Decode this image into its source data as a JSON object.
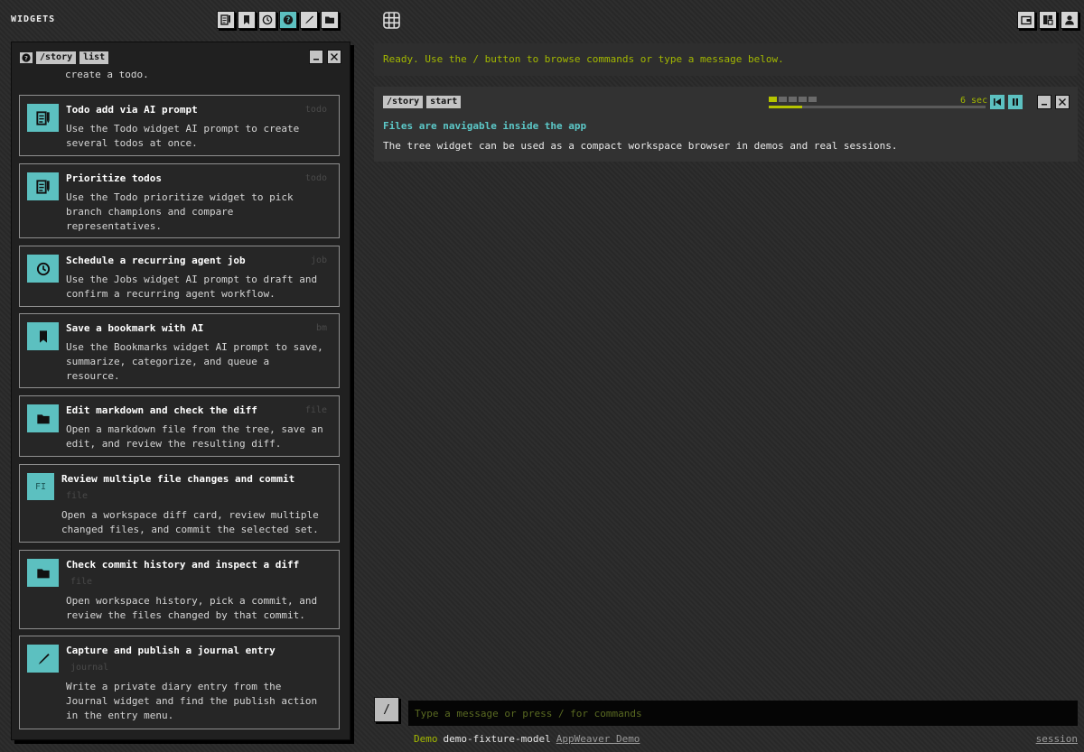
{
  "sidebar": {
    "title": "WIDGETS",
    "tools": [
      {
        "icon": "todo-icon",
        "active": false
      },
      {
        "icon": "bookmark-icon",
        "active": false
      },
      {
        "icon": "clock-icon",
        "active": false
      },
      {
        "icon": "help-icon",
        "active": true
      },
      {
        "icon": "pen-icon",
        "active": false
      },
      {
        "icon": "folder-icon",
        "active": false
      }
    ],
    "panel": {
      "chips": [
        "/story",
        "list"
      ],
      "partial_text": "create a todo.",
      "cards": [
        {
          "title": "Todo add via AI prompt",
          "tag": "todo",
          "icon": "todo-icon",
          "desc": [
            "Use the Todo widget AI prompt to create",
            "several todos at once."
          ]
        },
        {
          "title": "Prioritize todos",
          "tag": "todo",
          "icon": "todo-icon",
          "desc": [
            "Use the Todo prioritize widget to pick",
            "branch champions and compare",
            "representatives."
          ]
        },
        {
          "title": "Schedule a recurring agent job",
          "tag": "job",
          "icon": "clock-icon",
          "desc": [
            "Use the Jobs widget AI prompt to draft and",
            "confirm a recurring agent workflow."
          ]
        },
        {
          "title": "Save a bookmark with AI",
          "tag": "bm",
          "icon": "bookmark-icon",
          "desc": [
            "Use the Bookmarks widget AI prompt to save,",
            "summarize, categorize, and queue a",
            "resource."
          ]
        },
        {
          "title": "Edit markdown and check the diff",
          "tag": "file",
          "icon": "folder-icon",
          "desc": [
            "Open a markdown file from the tree, save an",
            "edit, and review the resulting diff."
          ]
        },
        {
          "title": "Review multiple file changes and commit",
          "tag": "file",
          "icon_text": "FI",
          "desc": [
            "Open a workspace diff card, review multiple",
            "changed files, and commit the selected set."
          ]
        },
        {
          "title": "Check commit history and inspect a diff",
          "tag": "file",
          "icon": "folder-icon",
          "desc": [
            "Open workspace history, pick a commit, and",
            "review the files changed by that commit."
          ]
        },
        {
          "title": "Capture and publish a journal entry",
          "tag": "journal",
          "icon": "pen-icon",
          "desc": [
            "Write a private diary entry from the",
            "Journal widget and find the publish action",
            "in the entry menu."
          ]
        }
      ]
    }
  },
  "topbar": {
    "right_tools": [
      "wallet-icon",
      "layout-icon",
      "user-icon"
    ]
  },
  "main": {
    "status": "Ready. Use the / button to browse commands or type a message below.",
    "story": {
      "chips": [
        "/story",
        "start"
      ],
      "segments_total": 5,
      "segments_done": 1,
      "progress": 0.155,
      "seconds_label": "6 sec",
      "title": "Files are navigable inside the app",
      "text": "The tree widget can be used as a compact workspace browser in demos and real sessions."
    }
  },
  "input": {
    "slash_label": "/",
    "placeholder": "Type a message or press / for commands",
    "value": ""
  },
  "footer": {
    "demo": "Demo",
    "model": "demo-fixture-model",
    "app_link": "AppWeaver Demo",
    "session": "session"
  },
  "colors": {
    "accent": "#5cc0c0",
    "status": "#a3b800",
    "title": "#5cc8c8"
  }
}
